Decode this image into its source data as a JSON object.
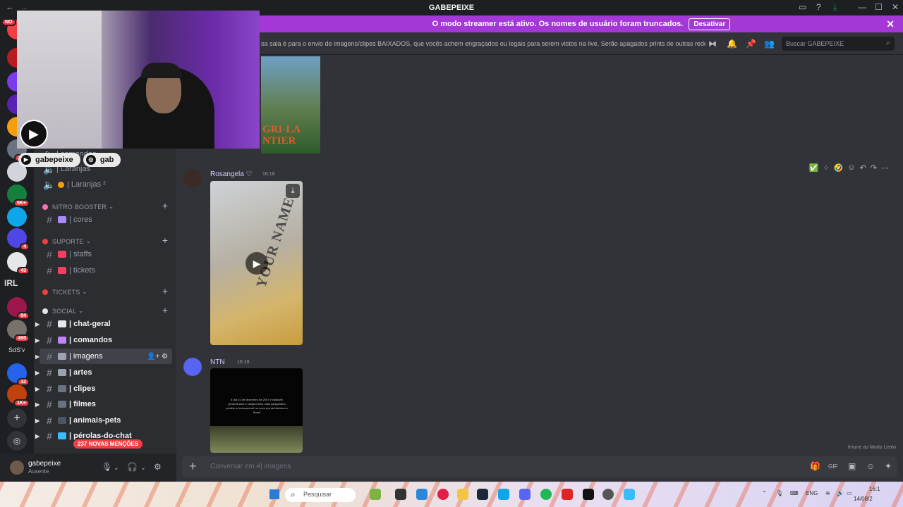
{
  "titlebar": {
    "title": "GABEPEIXE",
    "back": "←",
    "forward": "→",
    "inbox_icon": "▭",
    "help_icon": "?",
    "download_icon": "⤓",
    "min": "—",
    "max": "☐",
    "close": "✕"
  },
  "banner": {
    "text": "O modo streamer está ativo. Os nomes de usuário foram truncados.",
    "button": "Desativar",
    "close": "✕"
  },
  "guild_badges": [
    "NO",
    "363",
    "5K+",
    "4",
    "43",
    "84",
    "490",
    "32",
    "1K+"
  ],
  "guild_labels": [
    "IRL",
    "SdS'v"
  ],
  "sidebar": {
    "categories": {
      "nitro": "NITRO BOOSTER",
      "suporte": "SUPORTE",
      "tickets": "TICKETS",
      "social": "SOCIAL"
    },
    "channels": {
      "comandos_top": "| comandos",
      "laranjas1": "| Laranjas",
      "laranjas2": "| Laranjas ²",
      "cores": "| cores",
      "staffs": "| staffs",
      "tickets": "| tickets",
      "chat_geral": "| chat-geral",
      "comandos": "| comandos",
      "imagens": "| imagens",
      "artes": "| artes",
      "clipes": "| clipes",
      "filmes": "| filmes",
      "animais": "| animais-pets",
      "perolas": "| pérolas-do-chat"
    },
    "mentions": "237 NOVAS MENÇÕES"
  },
  "user": {
    "name": "gabepeixe",
    "status": "Ausente"
  },
  "header": {
    "topic": "sa sala é para o envio de imagens/clipes BAIXADOS, que vocês achem engraçados ou legais para serem vistos na live. Serão apagados prints de outras rede...",
    "search_placeholder": "Buscar GABEPEIXE"
  },
  "messages": [
    {
      "author": "Rosangela ♡",
      "time": "16:18",
      "media_text": "YOUR NAME"
    },
    {
      "author": "NTN",
      "time": "16:18",
      "media_text": "E dia 31 de dezembro de 2007 e natanzin perseverante e cafajeu filme mais sanguinário perdido e inesquecível na nova era da história no Brasil"
    }
  ],
  "prev_thumb_text": [
    "GRI-LA",
    "NTIER"
  ],
  "slowmode": "Imune ao Modo Lento",
  "composer": {
    "placeholder_prefix": "Conversar em #",
    "placeholder_channel": "| imagens"
  },
  "stream": {
    "handles": [
      "gabepeixe",
      "gab"
    ]
  },
  "taskbar": {
    "search": "Pesquisar",
    "lang": "ENG",
    "time": "16:1",
    "date": "14/08/2"
  },
  "colors": {
    "banner": "#a338d6",
    "mention": "#f23f43",
    "active_channel": "#404249"
  }
}
